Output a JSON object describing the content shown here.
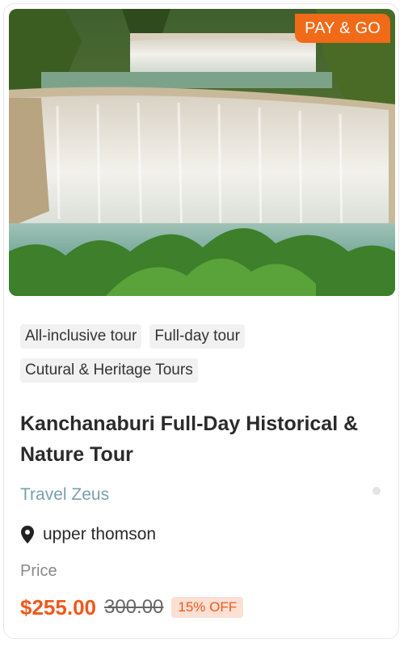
{
  "card": {
    "badge": "PAY & GO",
    "tags": [
      "All-inclusive tour",
      "Full-day tour",
      "Cutural & Heritage Tours"
    ],
    "title": "Kanchanaburi Full-Day Historical & Nature Tour",
    "provider": "Travel Zeus",
    "location": "upper thomson",
    "price_label": "Price",
    "price": "$255.00",
    "original_price": "300.00",
    "discount": "15% OFF"
  },
  "colors": {
    "accent": "#f06a18",
    "price": "#f0581c",
    "provider": "#7aa0ad",
    "tag_bg": "#f1f1f1"
  },
  "icons": {
    "location": "map-pin-icon"
  }
}
